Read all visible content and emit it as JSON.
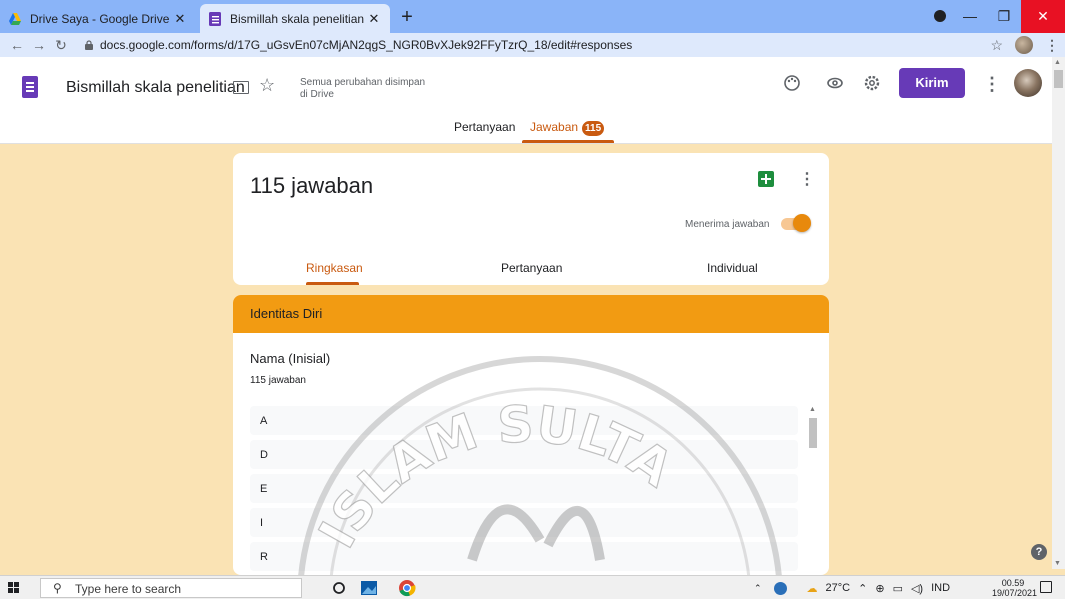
{
  "browser": {
    "tabs": [
      {
        "title": "Drive Saya - Google Drive",
        "active": false
      },
      {
        "title": "Bismillah skala penelitian - Goog",
        "active": true
      }
    ],
    "new_tab": "+",
    "url": "docs.google.com/forms/d/17G_uGsvEn07cMjAN2qgS_NGR0BvXJek92FFyTzrQ_18/edit#responses"
  },
  "header": {
    "doc_title": "Bismillah skala penelitian",
    "save_status": "Semua perubahan disimpan di Drive",
    "send_label": "Kirim",
    "tabs": {
      "questions": "Pertanyaan",
      "responses": "Jawaban",
      "responses_badge": "115"
    }
  },
  "summary": {
    "count_title": "115 jawaban",
    "accepting_label": "Menerima jawaban",
    "accepting": true,
    "subtabs": [
      "Ringkasan",
      "Pertanyaan",
      "Individual"
    ]
  },
  "section": {
    "title": "Identitas Diri",
    "question": "Nama (Inisial)",
    "question_count": "115 jawaban",
    "answers": [
      "A",
      "D",
      "E",
      "I",
      "R"
    ]
  },
  "watermark": {
    "text": "ISLAM SULTA"
  },
  "taskbar": {
    "search_placeholder": "Type here to search",
    "temperature": "27°C",
    "language": "IND",
    "time": "00.59",
    "date": "19/07/2021"
  },
  "colors": {
    "accent": "#c95a10",
    "section_header": "#f29b12",
    "page_bg": "#fae3b4",
    "forms_purple": "#673ab7"
  }
}
